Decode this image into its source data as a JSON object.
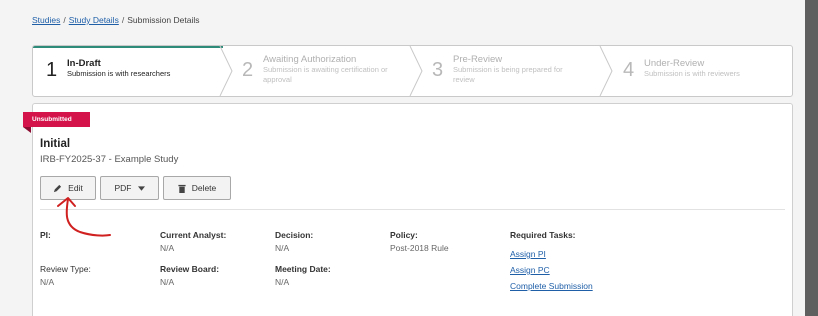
{
  "breadcrumb": {
    "studies": "Studies",
    "study_details": "Study Details",
    "current": "Submission Details",
    "separator": "/"
  },
  "stepper": [
    {
      "number": "1",
      "title": "In-Draft",
      "subtitle": "Submission is with researchers",
      "state": "active"
    },
    {
      "number": "2",
      "title": "Awaiting Authorization",
      "subtitle": "Submission is awaiting certification or approval",
      "state": "inactive"
    },
    {
      "number": "3",
      "title": "Pre-Review",
      "subtitle": "Submission is being prepared for review",
      "state": "inactive"
    },
    {
      "number": "4",
      "title": "Under-Review",
      "subtitle": "Submission is with reviewers",
      "state": "inactive"
    }
  ],
  "submission": {
    "badge": "Unsubmitted",
    "title": "Initial",
    "study_id": "IRB-FY2025-37 - Example Study"
  },
  "actions": {
    "edit_label": "Edit",
    "edit_icon": "pencil-icon",
    "pdf_label": "PDF",
    "pdf_icon": "caret-down-icon",
    "delete_label": "Delete",
    "delete_icon": "trash-icon"
  },
  "details": {
    "pi_label": "PI:",
    "analyst_label": "Current Analyst:",
    "analyst_value": "N/A",
    "decision_label": "Decision:",
    "decision_value": "N/A",
    "policy_label": "Policy:",
    "policy_value": "Post-2018 Rule",
    "review_type_label": "Review Type:",
    "review_type_value": "N/A",
    "review_board_label": "Review Board:",
    "review_board_value": "N/A",
    "meeting_date_label": "Meeting Date:",
    "meeting_date_value": "N/A"
  },
  "required_tasks": {
    "label": "Required Tasks:",
    "items": [
      "Assign PI",
      "Assign PC",
      "Complete Submission"
    ]
  },
  "colors": {
    "badge": "#d3134a",
    "link": "#1f5fa8",
    "active_step_accent": "#2e8b7a",
    "annotation": "#d02020"
  }
}
